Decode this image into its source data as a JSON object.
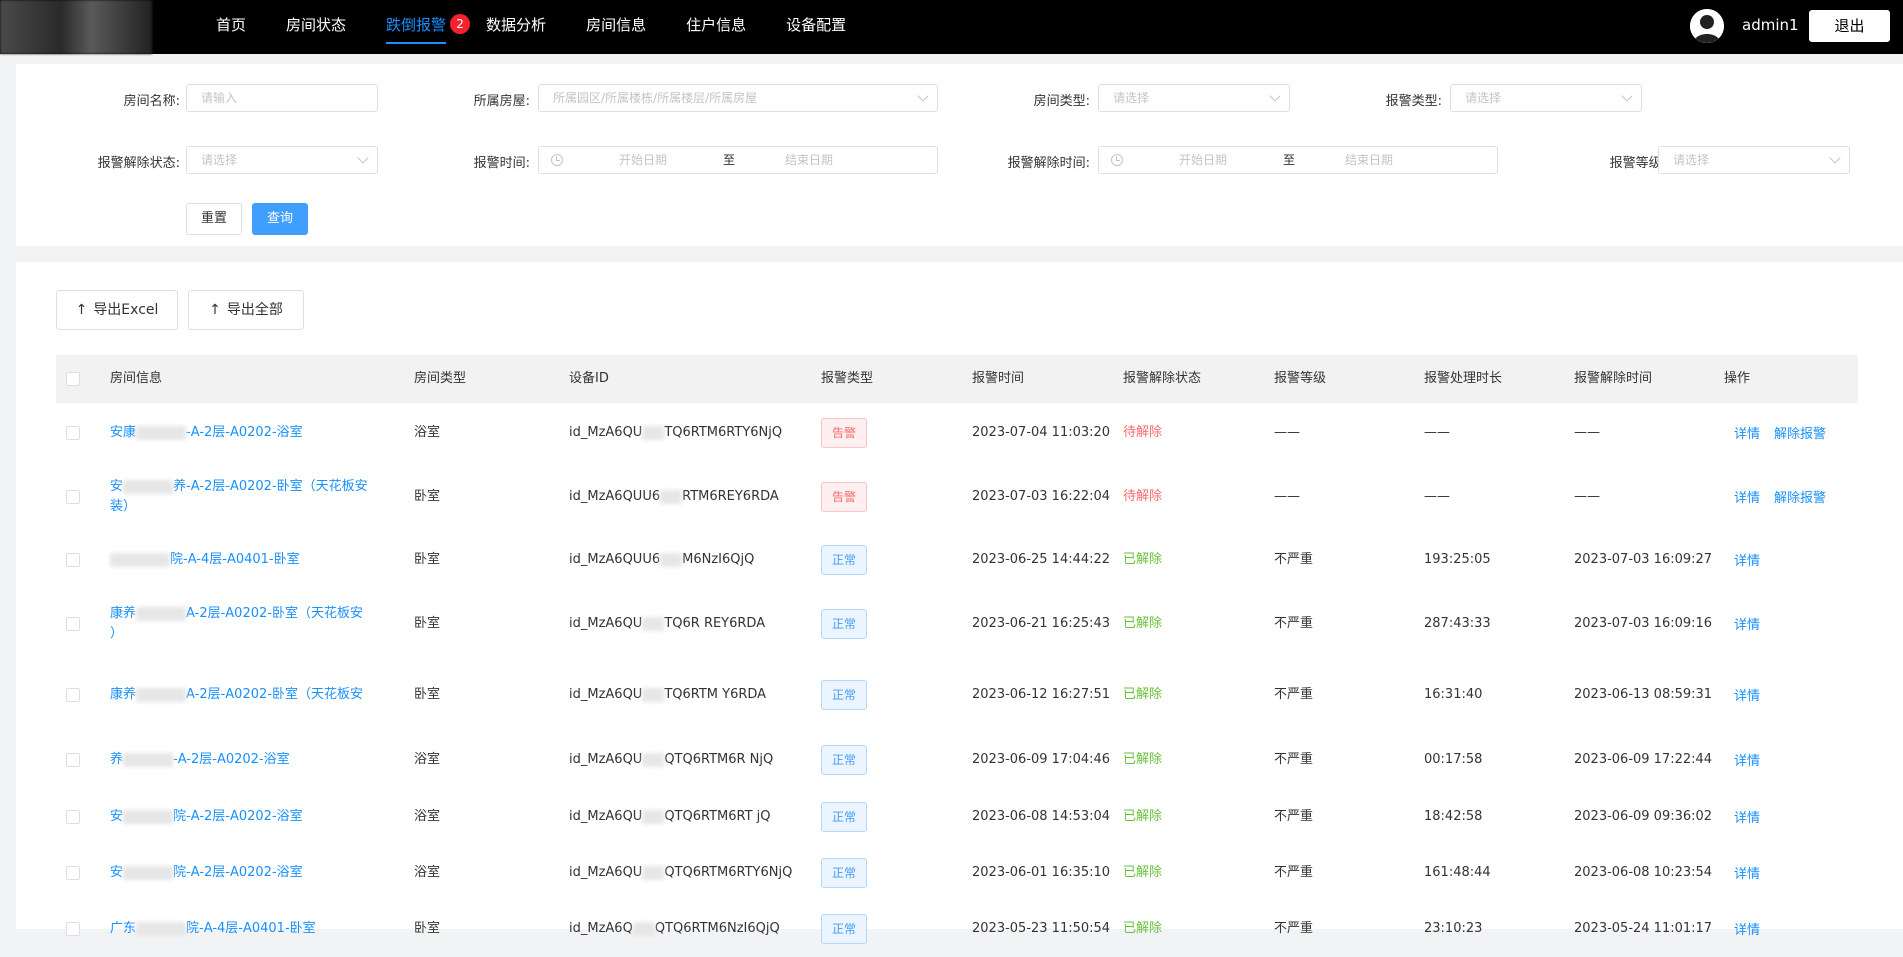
{
  "nav": {
    "items": [
      {
        "label": "首页",
        "active": false
      },
      {
        "label": "房间状态",
        "active": false
      },
      {
        "label": "跌倒报警",
        "active": true,
        "badge": "2"
      },
      {
        "label": "数据分析",
        "active": false
      },
      {
        "label": "房间信息",
        "active": false
      },
      {
        "label": "住户信息",
        "active": false
      },
      {
        "label": "设备配置",
        "active": false
      }
    ],
    "username": "admin1",
    "logout_label": "退出"
  },
  "filters": {
    "room_name": {
      "label": "房间名称:",
      "placeholder": "请输入"
    },
    "house": {
      "label": "所属房屋:",
      "placeholder": "所属园区/所属楼栋/所属楼层/所属房屋"
    },
    "room_type": {
      "label": "房间类型:",
      "placeholder": "请选择"
    },
    "alarm_type": {
      "label": "报警类型:",
      "placeholder": "请选择"
    },
    "release_status": {
      "label": "报警解除状态:",
      "placeholder": "请选择"
    },
    "alarm_time": {
      "label": "报警时间:",
      "start": "开始日期",
      "sep": "至",
      "end": "结束日期"
    },
    "release_time": {
      "label": "报警解除时间:",
      "start": "开始日期",
      "sep": "至",
      "end": "结束日期"
    },
    "alarm_level": {
      "label": "报警等级:",
      "placeholder": "请选择"
    },
    "reset_label": "重置",
    "query_label": "查询"
  },
  "export": {
    "excel_label": "导出Excel",
    "all_label": "导出全部"
  },
  "table": {
    "headers": [
      "房间信息",
      "房间类型",
      "设备ID",
      "报警类型",
      "报警时间",
      "报警解除状态",
      "报警等级",
      "报警处理时长",
      "报警解除时间",
      "操作"
    ],
    "detail_label": "详情",
    "release_label": "解除报警",
    "rows": [
      {
        "room_a": "安康",
        "room_b": "-A-2层-A0202-浴室",
        "room_line2": "",
        "type": "浴室",
        "dev_a": "id_MzA6QU",
        "dev_b": "TQ6RTM6RTY6NjQ",
        "alarm": "告警",
        "alarm_kind": "alarm",
        "time": "2023-07-04 11:03:20",
        "status": "待解除",
        "status_kind": "pending",
        "level": "——",
        "duration": "——",
        "release_time": "——",
        "can_release": true
      },
      {
        "room_a": "安",
        "room_b": "养-A-2层-A0202-卧室（天花板安",
        "room_line2": "装）",
        "type": "卧室",
        "dev_a": "id_MzA6QUU6",
        "dev_b": "RTM6REY6RDA",
        "alarm": "告警",
        "alarm_kind": "alarm",
        "time": "2023-07-03 16:22:04",
        "status": "待解除",
        "status_kind": "pending",
        "level": "——",
        "duration": "——",
        "release_time": "——",
        "can_release": true
      },
      {
        "room_a": "",
        "room_b": "院-A-4层-A0401-卧室",
        "room_line2": "",
        "type": "卧室",
        "dev_a": "id_MzA6QUU6",
        "dev_b": "M6NzI6QjQ",
        "alarm": "正常",
        "alarm_kind": "normal",
        "time": "2023-06-25 14:44:22",
        "status": "已解除",
        "status_kind": "done",
        "level": "不严重",
        "duration": "193:25:05",
        "release_time": "2023-07-03 16:09:27",
        "can_release": false
      },
      {
        "room_a": "康养",
        "room_b": "A-2层-A0202-卧室（天花板安",
        "room_line2": "）",
        "type": "卧室",
        "dev_a": "id_MzA6QU",
        "dev_b": "TQ6R   REY6RDA",
        "alarm": "正常",
        "alarm_kind": "normal",
        "time": "2023-06-21 16:25:43",
        "status": "已解除",
        "status_kind": "done",
        "level": "不严重",
        "duration": "287:43:33",
        "release_time": "2023-07-03 16:09:16",
        "can_release": false
      },
      {
        "room_a": "康养",
        "room_b": "A-2层-A0202-卧室（天花板安",
        "room_line2": "",
        "type": "卧室",
        "dev_a": "id_MzA6QU",
        "dev_b": "TQ6RTM   Y6RDA",
        "alarm": "正常",
        "alarm_kind": "normal",
        "time": "2023-06-12 16:27:51",
        "status": "已解除",
        "status_kind": "done",
        "level": "不严重",
        "duration": "16:31:40",
        "release_time": "2023-06-13 08:59:31",
        "can_release": false
      },
      {
        "room_a": "养",
        "room_b": "-A-2层-A0202-浴室",
        "room_line2": "",
        "type": "浴室",
        "dev_a": "id_MzA6QU",
        "dev_b": "QTQ6RTM6R   NjQ",
        "alarm": "正常",
        "alarm_kind": "normal",
        "time": "2023-06-09 17:04:46",
        "status": "已解除",
        "status_kind": "done",
        "level": "不严重",
        "duration": "00:17:58",
        "release_time": "2023-06-09 17:22:44",
        "can_release": false
      },
      {
        "room_a": "安",
        "room_b": "院-A-2层-A0202-浴室",
        "room_line2": "",
        "type": "浴室",
        "dev_a": "id_MzA6QU",
        "dev_b": "QTQ6RTM6RT   jQ",
        "alarm": "正常",
        "alarm_kind": "normal",
        "time": "2023-06-08 14:53:04",
        "status": "已解除",
        "status_kind": "done",
        "level": "不严重",
        "duration": "18:42:58",
        "release_time": "2023-06-09 09:36:02",
        "can_release": false
      },
      {
        "room_a": "安",
        "room_b": "院-A-2层-A0202-浴室",
        "room_line2": "",
        "type": "浴室",
        "dev_a": "id_MzA6QU",
        "dev_b": "QTQ6RTM6RTY6NjQ",
        "alarm": "正常",
        "alarm_kind": "normal",
        "time": "2023-06-01 16:35:10",
        "status": "已解除",
        "status_kind": "done",
        "level": "不严重",
        "duration": "161:48:44",
        "release_time": "2023-06-08 10:23:54",
        "can_release": false
      },
      {
        "room_a": "广东",
        "room_b": "院-A-4层-A0401-卧室",
        "room_line2": "",
        "type": "卧室",
        "dev_a": "id_MzA6Q",
        "dev_b": "QTQ6RTM6NzI6QjQ",
        "alarm": "正常",
        "alarm_kind": "normal",
        "time": "2023-05-23 11:50:54",
        "status": "已解除",
        "status_kind": "done",
        "level": "不严重",
        "duration": "23:10:23",
        "release_time": "2023-05-24 11:01:17",
        "can_release": false
      }
    ]
  }
}
